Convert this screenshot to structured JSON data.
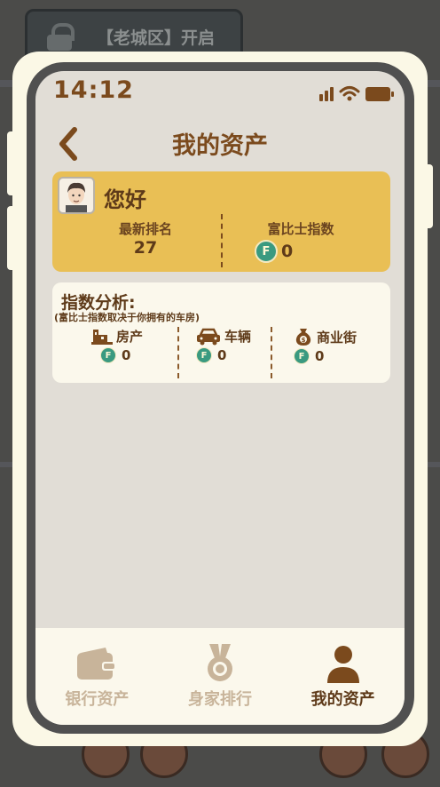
{
  "background": {
    "locked_area_label": "【老城区】开启"
  },
  "status_bar": {
    "time": "14:12"
  },
  "header": {
    "title": "我的资产"
  },
  "summary": {
    "greeting": "您好",
    "rank_label": "最新排名",
    "rank_value": "27",
    "index_label": "富比士指数",
    "index_value": "0"
  },
  "analysis": {
    "title": "指数分析:",
    "note": "(富比士指数取决于你拥有的车房)",
    "categories": [
      {
        "label": "房产",
        "value": "0",
        "icon": "house-icon"
      },
      {
        "label": "车辆",
        "value": "0",
        "icon": "car-icon"
      },
      {
        "label": "商业街",
        "value": "0",
        "icon": "money-bag-icon"
      }
    ]
  },
  "coin_symbol": "F",
  "nav": {
    "items": [
      {
        "label": "银行资产",
        "icon": "wallet-icon",
        "active": false
      },
      {
        "label": "身家排行",
        "icon": "medal-icon",
        "active": false
      },
      {
        "label": "我的资产",
        "icon": "person-icon",
        "active": true
      }
    ]
  },
  "colors": {
    "accent": "#7b4a1d",
    "card_yellow": "#e9bf55",
    "coin": "#3a9a80",
    "inactive_nav": "#c8b49a"
  }
}
